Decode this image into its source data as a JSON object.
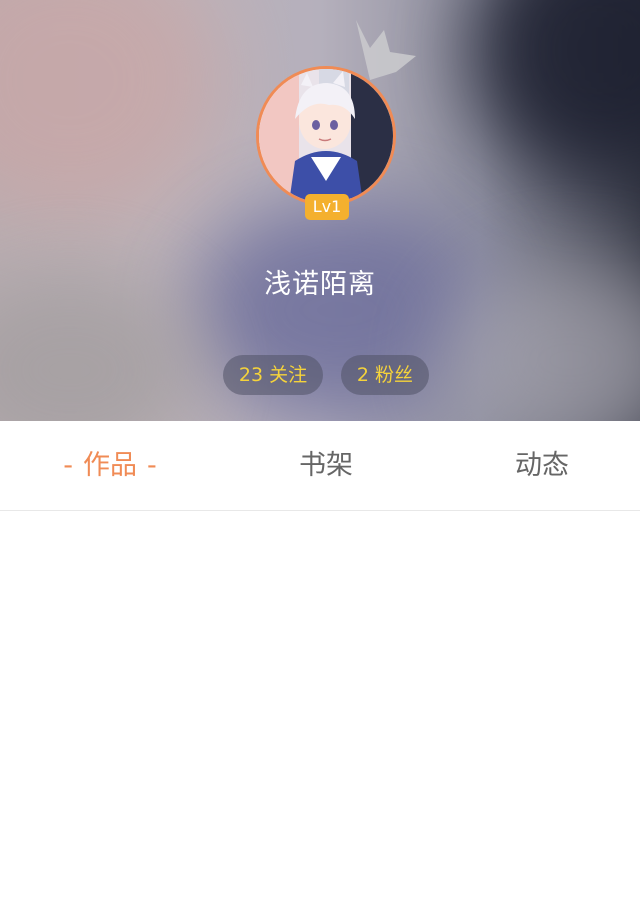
{
  "profile": {
    "username": "浅诺陌离",
    "level_badge": "Lv1",
    "following_label": "23 关注",
    "followers_label": "2 粉丝"
  },
  "tabs": [
    {
      "label": "作品",
      "active": true
    },
    {
      "label": "书架",
      "active": false
    },
    {
      "label": "动态",
      "active": false
    }
  ],
  "active_tab_decoration": "-",
  "colors": {
    "accent": "#f08b55",
    "level_badge": "#f4b02e",
    "stat_text": "#f5d33b",
    "tab_inactive": "#666666"
  },
  "icons": {
    "crown": "crown-icon",
    "avatar": "avatar-image"
  }
}
